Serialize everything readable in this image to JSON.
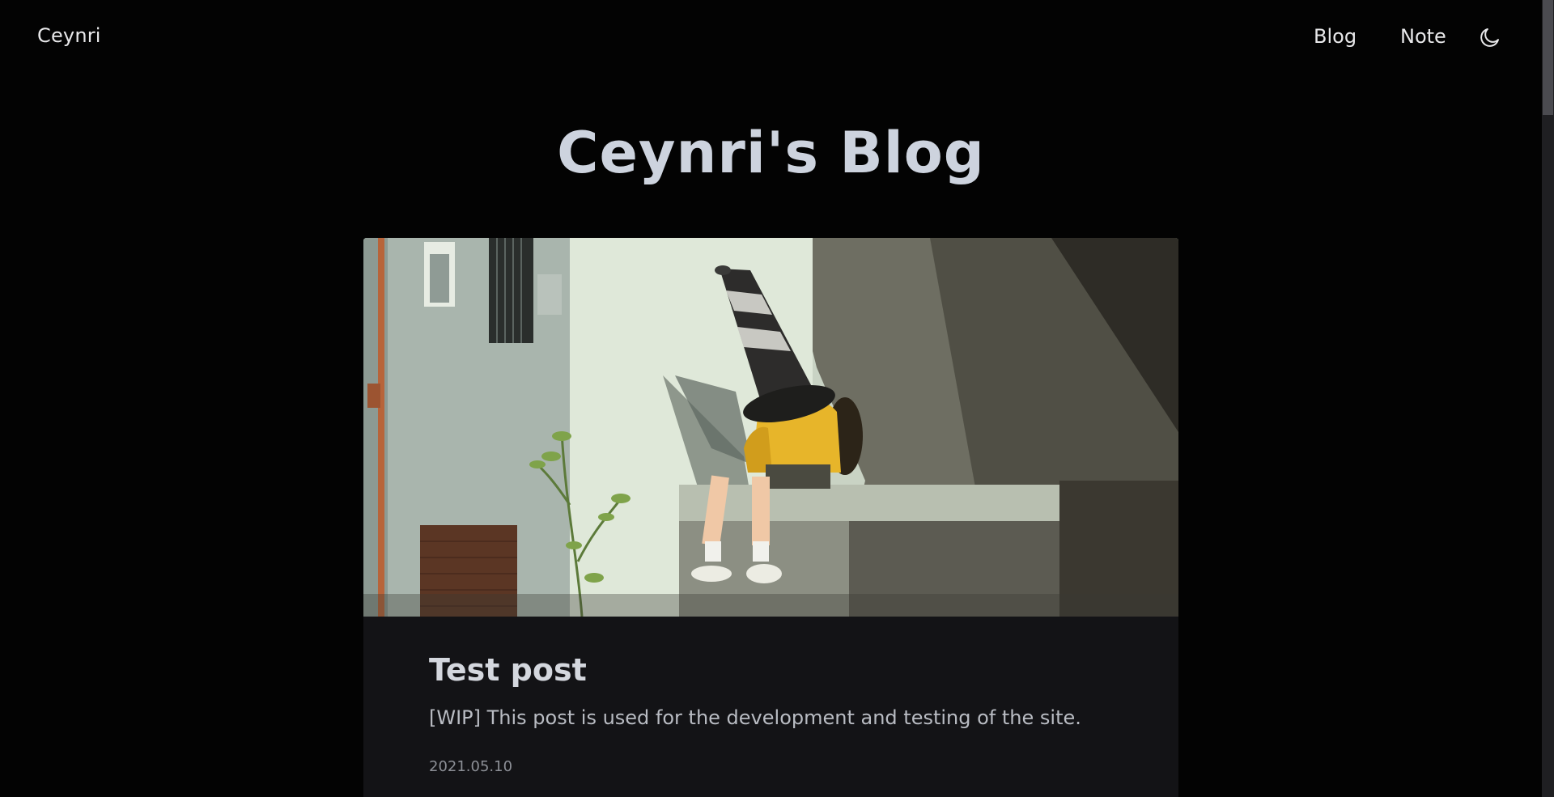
{
  "nav": {
    "brand": "Ceynri",
    "links": [
      {
        "label": "Blog"
      },
      {
        "label": "Note"
      }
    ],
    "theme_icon": "moon-icon"
  },
  "hero": {
    "title": "Ceynri's Blog"
  },
  "posts": [
    {
      "title": "Test post",
      "excerpt": "[WIP] This post is used for the development and testing of the site.",
      "date": "2021.05.10",
      "cover_description_icon": "cover-image"
    }
  ],
  "colors": {
    "background": "#030303",
    "card": "#131316",
    "title": "#cdd3de",
    "text": "#e8e8ea",
    "accent_yellow": "#e7b52a"
  }
}
